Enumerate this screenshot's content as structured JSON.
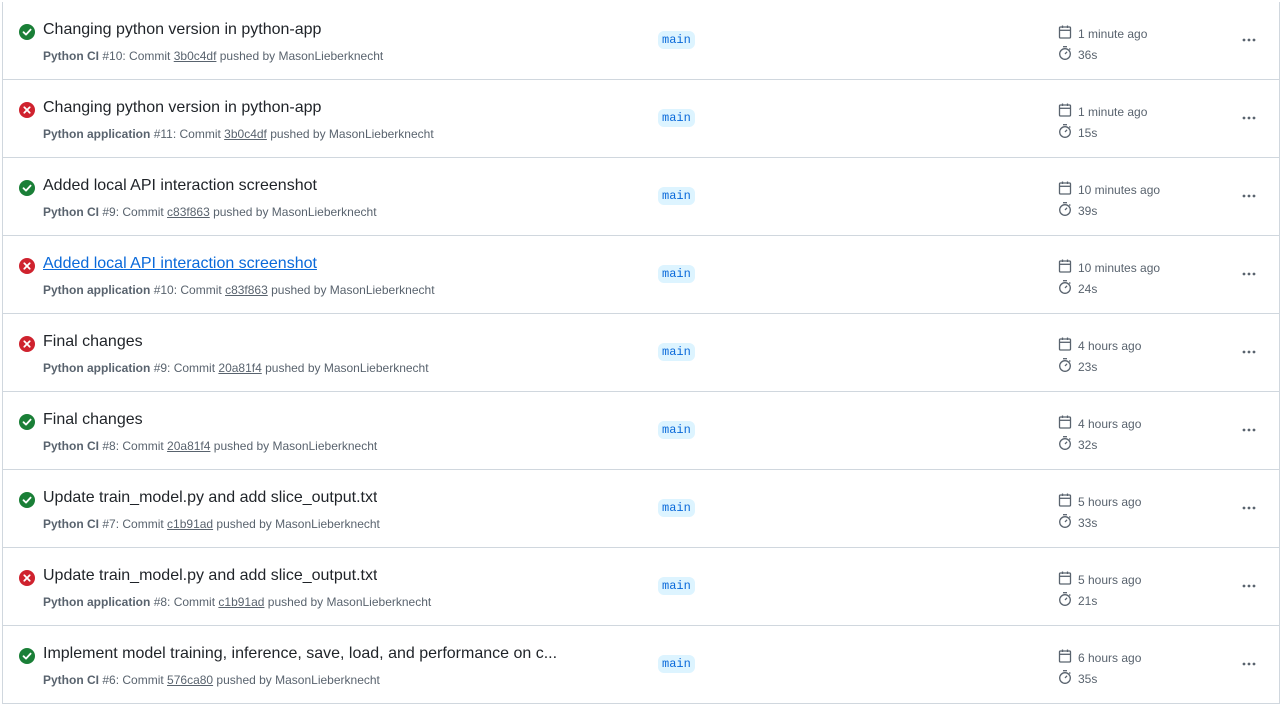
{
  "colors": {
    "success": "#1a7f37",
    "failure": "#cf222e",
    "link": "#0969da",
    "branch_bg": "#ddf4ff",
    "muted": "#59636e",
    "border": "#d0d7de"
  },
  "runs": [
    {
      "status": "success",
      "status_icon": "check-circle-icon",
      "title": "Changing python version in python-app",
      "workflow": "Python CI",
      "run_number": "#10",
      "commit_prefix": ": Commit ",
      "sha": "3b0c4df",
      "pushed_by": " pushed by MasonLieberknecht",
      "branch": "main",
      "when": "1 minute ago",
      "duration": "36s"
    },
    {
      "status": "failure",
      "status_icon": "x-circle-icon",
      "title": "Changing python version in python-app",
      "workflow": "Python application",
      "run_number": "#11",
      "commit_prefix": ": Commit ",
      "sha": "3b0c4df",
      "pushed_by": " pushed by MasonLieberknecht",
      "branch": "main",
      "when": "1 minute ago",
      "duration": "15s"
    },
    {
      "status": "success",
      "status_icon": "check-circle-icon",
      "title": "Added local API interaction screenshot",
      "workflow": "Python CI",
      "run_number": "#9",
      "commit_prefix": ": Commit ",
      "sha": "c83f863",
      "pushed_by": " pushed by MasonLieberknecht",
      "branch": "main",
      "when": "10 minutes ago",
      "duration": "39s"
    },
    {
      "status": "failure",
      "status_icon": "x-circle-icon",
      "title": "Added local API interaction screenshot",
      "title_hovered": true,
      "workflow": "Python application",
      "run_number": "#10",
      "commit_prefix": ": Commit ",
      "sha": "c83f863",
      "pushed_by": " pushed by MasonLieberknecht",
      "branch": "main",
      "when": "10 minutes ago",
      "duration": "24s"
    },
    {
      "status": "failure",
      "status_icon": "x-circle-icon",
      "title": "Final changes",
      "workflow": "Python application",
      "run_number": "#9",
      "commit_prefix": ": Commit ",
      "sha": "20a81f4",
      "pushed_by": " pushed by MasonLieberknecht",
      "branch": "main",
      "when": "4 hours ago",
      "duration": "23s"
    },
    {
      "status": "success",
      "status_icon": "check-circle-icon",
      "title": "Final changes",
      "workflow": "Python CI",
      "run_number": "#8",
      "commit_prefix": ": Commit ",
      "sha": "20a81f4",
      "pushed_by": " pushed by MasonLieberknecht",
      "branch": "main",
      "when": "4 hours ago",
      "duration": "32s"
    },
    {
      "status": "success",
      "status_icon": "check-circle-icon",
      "title": "Update train_model.py and add slice_output.txt",
      "workflow": "Python CI",
      "run_number": "#7",
      "commit_prefix": ": Commit ",
      "sha": "c1b91ad",
      "pushed_by": " pushed by MasonLieberknecht",
      "branch": "main",
      "when": "5 hours ago",
      "duration": "33s"
    },
    {
      "status": "failure",
      "status_icon": "x-circle-icon",
      "title": "Update train_model.py and add slice_output.txt",
      "workflow": "Python application",
      "run_number": "#8",
      "commit_prefix": ": Commit ",
      "sha": "c1b91ad",
      "pushed_by": " pushed by MasonLieberknecht",
      "branch": "main",
      "when": "5 hours ago",
      "duration": "21s"
    },
    {
      "status": "success",
      "status_icon": "check-circle-icon",
      "title": "Implement model training, inference, save, load, and performance on c...",
      "workflow": "Python CI",
      "run_number": "#6",
      "commit_prefix": ": Commit ",
      "sha": "576ca80",
      "pushed_by": " pushed by MasonLieberknecht",
      "branch": "main",
      "when": "6 hours ago",
      "duration": "35s"
    }
  ]
}
